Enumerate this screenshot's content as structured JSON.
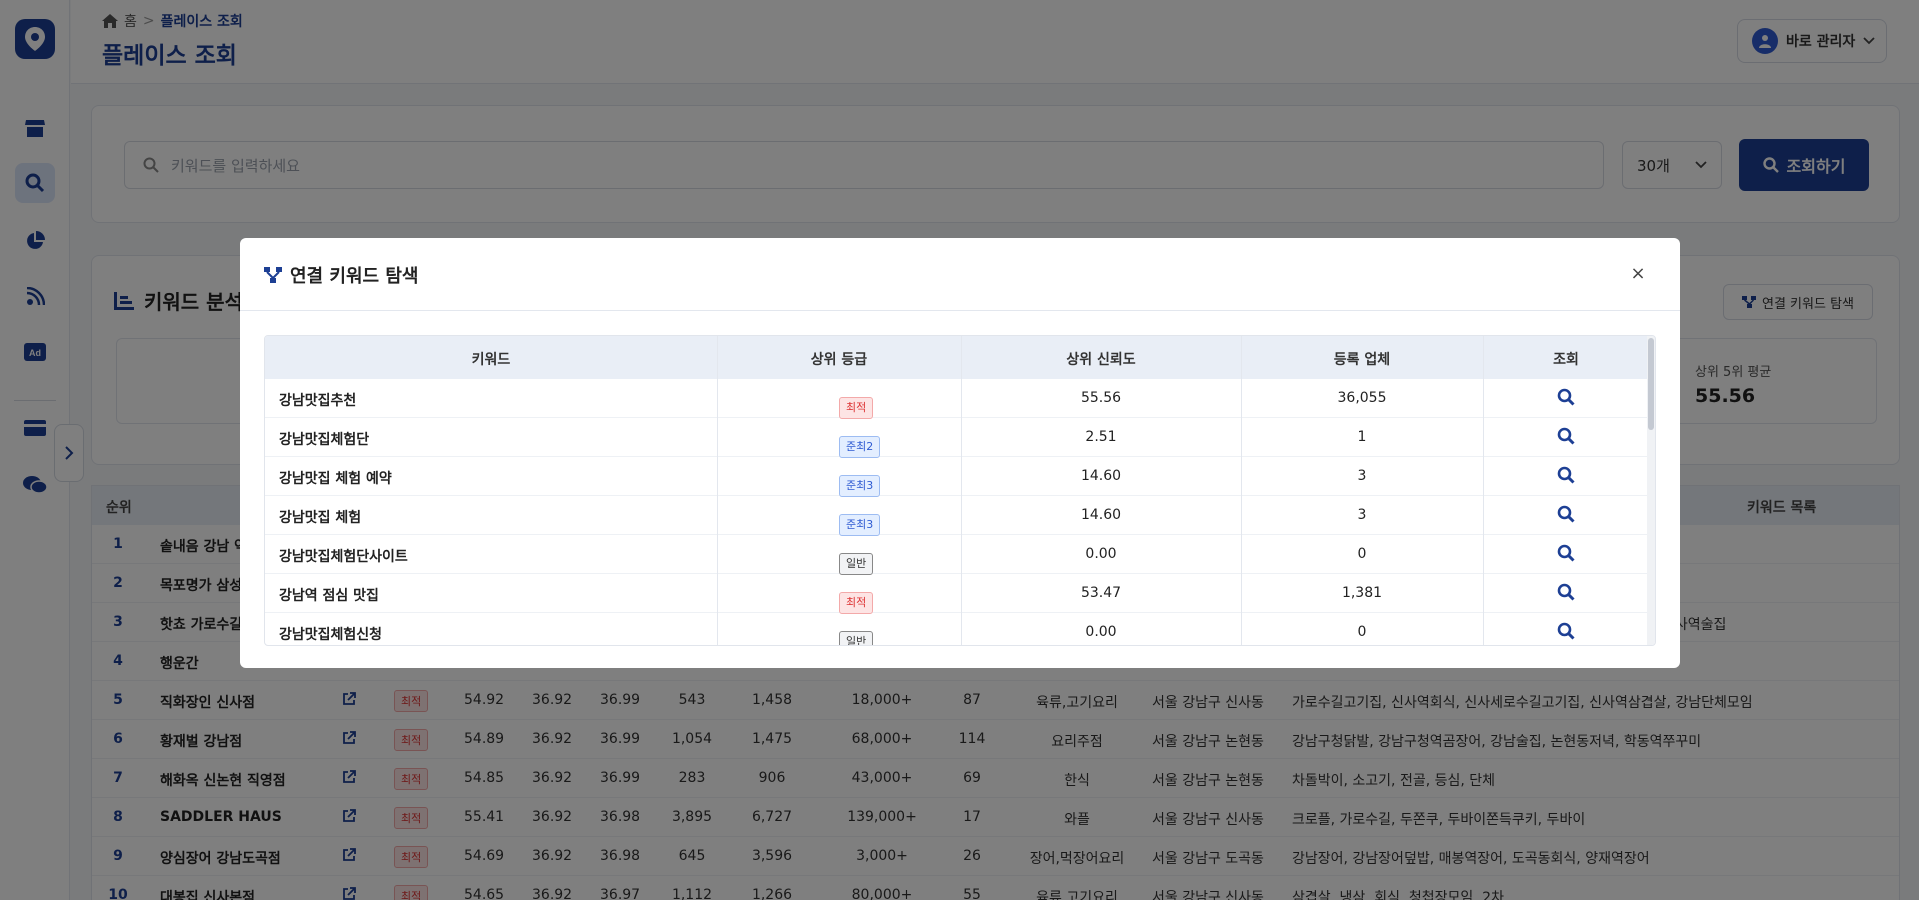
{
  "header": {
    "breadcrumb_home": "홈",
    "breadcrumb_current": "플레이스 조회",
    "page_title": "플레이스 조회",
    "user_label": "바로 관리자"
  },
  "search": {
    "placeholder": "키워드를 입력하세요",
    "count_value": "30개",
    "button_label": "조회하기"
  },
  "analysis": {
    "title": "키워드 분석",
    "link_button": "연결 키워드 탐색",
    "stat_label": "상위 5위 평균",
    "stat_value": "55.56"
  },
  "bg_table": {
    "header_rank": "순위",
    "header_keywords": "키워드 목록",
    "rows": [
      {
        "rank": "1",
        "name": "솥내음 강남 역",
        "grade": "",
        "c1": "",
        "c2": "",
        "c3": "",
        "c4": "",
        "c5": "",
        "c6": "",
        "c7": "",
        "c8": "",
        "c9": "",
        "c10": ""
      },
      {
        "rank": "2",
        "name": "목포명가 삼성",
        "grade": "",
        "c1": "",
        "c2": "",
        "c3": "",
        "c4": "",
        "c5": "",
        "c6": "",
        "c7": "",
        "c8": "",
        "c9": "",
        "c10": ""
      },
      {
        "rank": "3",
        "name": "핫쵸 가로수길",
        "grade": "",
        "c1": "",
        "c2": "",
        "c3": "",
        "c4": "",
        "c5": "",
        "c6": "",
        "c7": "",
        "c8": "",
        "c9": "",
        "c10": "신사역술집"
      },
      {
        "rank": "4",
        "name": "행운간",
        "grade": "",
        "c1": "",
        "c2": "",
        "c3": "",
        "c4": "",
        "c5": "",
        "c6": "",
        "c7": "",
        "c8": "",
        "c9": "",
        "c10": ""
      },
      {
        "rank": "5",
        "name": "직화장인 신사점",
        "grade": "최적",
        "c1": "54.92",
        "c2": "36.92",
        "c3": "36.99",
        "c4": "543",
        "c5": "1,458",
        "c6": "18,000+",
        "c7": "87",
        "c8": "육류,고기요리",
        "c9": "서울 강남구 신사동",
        "c10": "가로수길고기집, 신사역회식, 신사세로수길고기집, 신사역삼겹살, 강남단체모임"
      },
      {
        "rank": "6",
        "name": "황재벌 강남점",
        "grade": "최적",
        "c1": "54.89",
        "c2": "36.92",
        "c3": "36.99",
        "c4": "1,054",
        "c5": "1,475",
        "c6": "68,000+",
        "c7": "114",
        "c8": "요리주점",
        "c9": "서울 강남구 논현동",
        "c10": "강남구청닭발, 강남구청역곰장어, 강남술집, 논현동저녁, 학동역쭈꾸미"
      },
      {
        "rank": "7",
        "name": "해화옥 신논현 직영점",
        "grade": "최적",
        "c1": "54.85",
        "c2": "36.92",
        "c3": "36.99",
        "c4": "283",
        "c5": "906",
        "c6": "43,000+",
        "c7": "69",
        "c8": "한식",
        "c9": "서울 강남구 논현동",
        "c10": "차돌박이, 소고기, 전골, 등심, 단체"
      },
      {
        "rank": "8",
        "name": "SADDLER HAUS",
        "grade": "최적",
        "c1": "55.41",
        "c2": "36.92",
        "c3": "36.98",
        "c4": "3,895",
        "c5": "6,727",
        "c6": "139,000+",
        "c7": "17",
        "c8": "와플",
        "c9": "서울 강남구 신사동",
        "c10": "크로플, 가로수길, 두쫀쿠, 두바이쫀득쿠키, 두바이"
      },
      {
        "rank": "9",
        "name": "양심장어 강남도곡점",
        "grade": "최적",
        "c1": "54.69",
        "c2": "36.92",
        "c3": "36.98",
        "c4": "645",
        "c5": "3,596",
        "c6": "3,000+",
        "c7": "26",
        "c8": "장어,먹장어요리",
        "c9": "서울 강남구 도곡동",
        "c10": "강남장어, 강남장어덮밥, 매봉역장어, 도곡동회식, 양재역장어"
      },
      {
        "rank": "10",
        "name": "대봉집 신사본점",
        "grade": "최적",
        "c1": "54.65",
        "c2": "36.92",
        "c3": "36.97",
        "c4": "1,112",
        "c5": "1,266",
        "c6": "80,000+",
        "c7": "55",
        "c8": "육류,고기요리",
        "c9": "서울 강남구 신사동",
        "c10": "삼겹살, 냉삼, 회식, 청첩장모임, 2차"
      }
    ]
  },
  "modal": {
    "title": "연결 키워드 탐색",
    "close_label": "×",
    "headers": {
      "keyword": "키워드",
      "grade": "상위 등급",
      "trust": "상위 신뢰도",
      "count": "등록 업체",
      "view": "조회"
    },
    "rows": [
      {
        "keyword": "강남맛집추천",
        "grade": "최적",
        "grade_type": "top",
        "trust": "55.56",
        "count": "36,055"
      },
      {
        "keyword": "강남맛집체험단",
        "grade": "준최2",
        "grade_type": "semi",
        "trust": "2.51",
        "count": "1"
      },
      {
        "keyword": "강남맛집 체험 예약",
        "grade": "준최3",
        "grade_type": "semi",
        "trust": "14.60",
        "count": "3"
      },
      {
        "keyword": "강남맛집 체험",
        "grade": "준최3",
        "grade_type": "semi",
        "trust": "14.60",
        "count": "3"
      },
      {
        "keyword": "강남맛집체험단사이트",
        "grade": "일반",
        "grade_type": "normal",
        "trust": "0.00",
        "count": "0"
      },
      {
        "keyword": "강남역 점심 맛집",
        "grade": "최적",
        "grade_type": "top",
        "trust": "53.47",
        "count": "1,381"
      },
      {
        "keyword": "강남맛집체험신청",
        "grade": "일반",
        "grade_type": "normal",
        "trust": "0.00",
        "count": "0"
      }
    ]
  },
  "colors": {
    "brand": "#1d3f94",
    "top_badge": "#d33333",
    "semi_badge": "#2f5bd2"
  },
  "icons": [
    "map-pin-icon",
    "store-icon",
    "search-place-icon",
    "pie-chart-icon",
    "signal-icon",
    "ad-icon",
    "card-icon",
    "chat-icon",
    "chevron-right-icon",
    "home-icon",
    "user-icon",
    "chevron-down-icon",
    "search-icon",
    "network-icon",
    "external-link-icon",
    "close-icon"
  ]
}
